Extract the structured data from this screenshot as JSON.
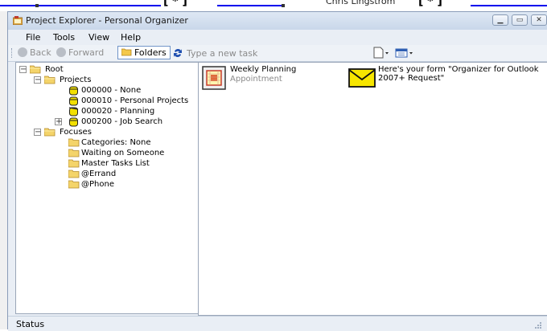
{
  "window": {
    "title": "Project Explorer - Personal Organizer"
  },
  "menu": [
    "File",
    "Tools",
    "View",
    "Help"
  ],
  "toolbar": {
    "back_label": "Back",
    "forward_label": "Forward",
    "folders_label": "Folders",
    "task_placeholder": "Type a new task"
  },
  "tree": [
    {
      "label": "Root",
      "expander": "−"
    },
    {
      "label": "Projects",
      "expander": "−"
    },
    {
      "label": "000000 - None",
      "expander": ""
    },
    {
      "label": "000010 - Personal Projects",
      "expander": ""
    },
    {
      "label": "000020 - Planning",
      "expander": ""
    },
    {
      "label": "000200 - Job Search",
      "expander": "+"
    },
    {
      "label": "Focuses",
      "expander": "−"
    },
    {
      "label": "Categories: None",
      "expander": ""
    },
    {
      "label": "Waiting on Someone",
      "expander": ""
    },
    {
      "label": "Master Tasks List",
      "expander": ""
    },
    {
      "label": "@Errand",
      "expander": ""
    },
    {
      "label": "@Phone",
      "expander": ""
    }
  ],
  "items": [
    {
      "title": "Weekly Planning",
      "subtitle": "Appointment",
      "icon": "appointment-icon"
    },
    {
      "title": "Here's your form \"Organizer for Outlook 2007+ Request\"",
      "subtitle": "",
      "icon": "envelope-icon"
    }
  ],
  "status": {
    "text": "Status"
  },
  "background": {
    "partial_name": "Chris Lingstrom",
    "bracket": "[ * ]"
  },
  "colors": {
    "window_bg": "#e9eef5",
    "link": "#0000ee",
    "folder": "#f4d46a",
    "project_folder": "#f2e000",
    "envelope": "#f7e600"
  }
}
